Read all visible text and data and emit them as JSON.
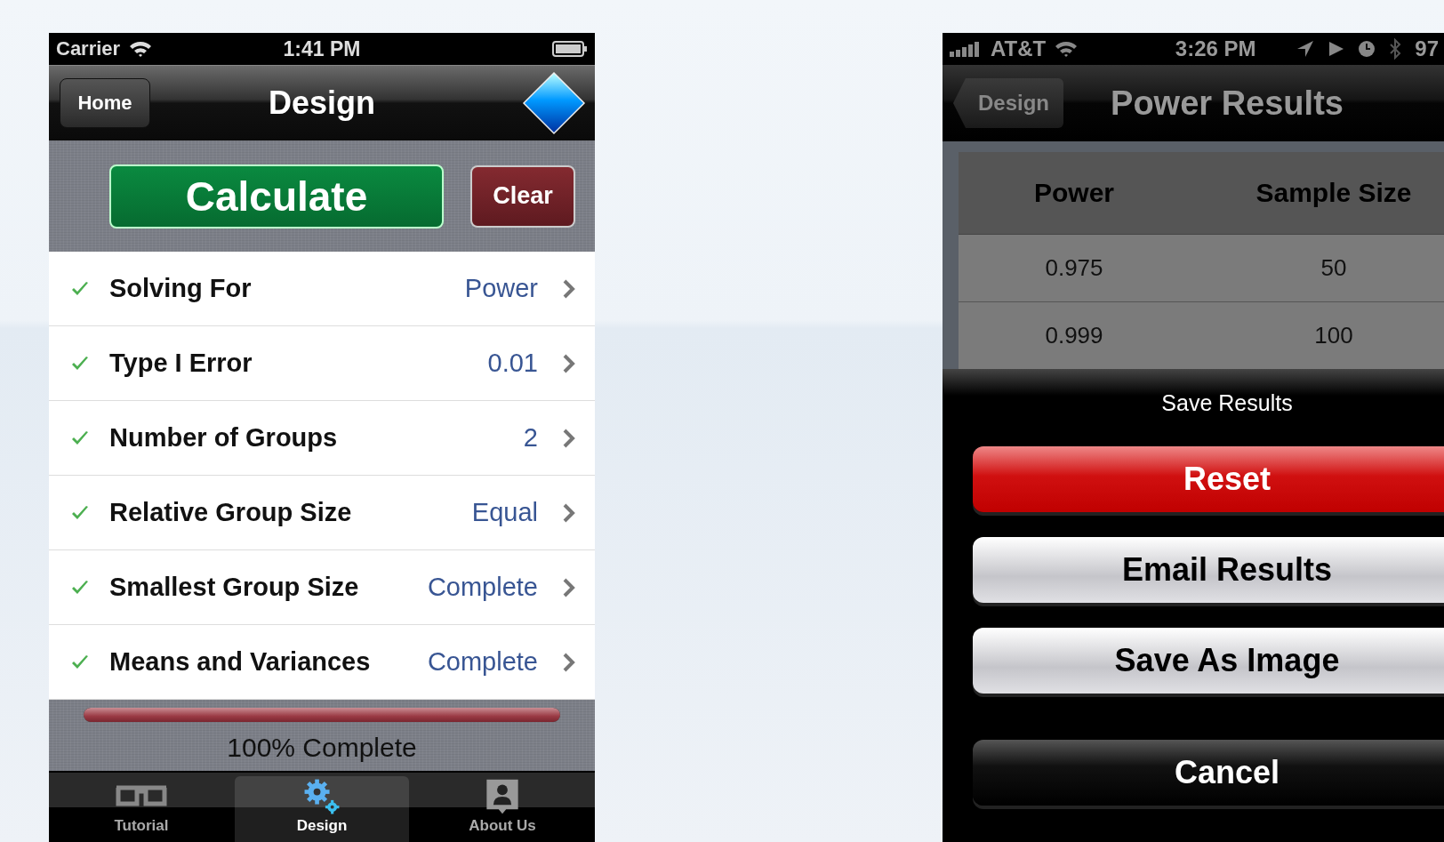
{
  "design_screen": {
    "status_bar": {
      "carrier": "Carrier",
      "time": "1:41 PM"
    },
    "nav": {
      "back": "Home",
      "title": "Design"
    },
    "buttons": {
      "calculate": "Calculate",
      "clear": "Clear"
    },
    "rows": [
      {
        "label": "Solving For",
        "value": "Power",
        "checked": true
      },
      {
        "label": "Type I Error",
        "value": "0.01",
        "checked": true
      },
      {
        "label": "Number of Groups",
        "value": "2",
        "checked": true
      },
      {
        "label": "Relative Group Size",
        "value": "Equal",
        "checked": true
      },
      {
        "label": "Smallest Group Size",
        "value": "Complete",
        "checked": true
      },
      {
        "label": "Means and Variances",
        "value": "Complete",
        "checked": true
      }
    ],
    "progress": {
      "level": 1.0,
      "caption": "100%  Complete"
    },
    "tabs": [
      {
        "label": "Tutorial",
        "kind": "glasses",
        "selected": false
      },
      {
        "label": "Design",
        "kind": "gears",
        "selected": true
      },
      {
        "label": "About Us",
        "kind": "person",
        "selected": false
      }
    ]
  },
  "results_screen": {
    "status_bar": {
      "carrier": "AT&T",
      "time": "3:26 PM",
      "battery": "97"
    },
    "nav": {
      "back": "Design",
      "title": "Power Results"
    },
    "table": {
      "columns": [
        "Power",
        "Sample Size"
      ],
      "rows": [
        [
          "0.975",
          "50"
        ],
        [
          "0.999",
          "100"
        ]
      ]
    },
    "action_sheet": {
      "title": "Save Results",
      "buttons": [
        {
          "label": "Reset",
          "kind": "destructive"
        },
        {
          "label": "Email Results",
          "kind": "default"
        },
        {
          "label": "Save As Image",
          "kind": "default"
        },
        {
          "label": "Cancel",
          "kind": "cancel"
        }
      ]
    }
  }
}
